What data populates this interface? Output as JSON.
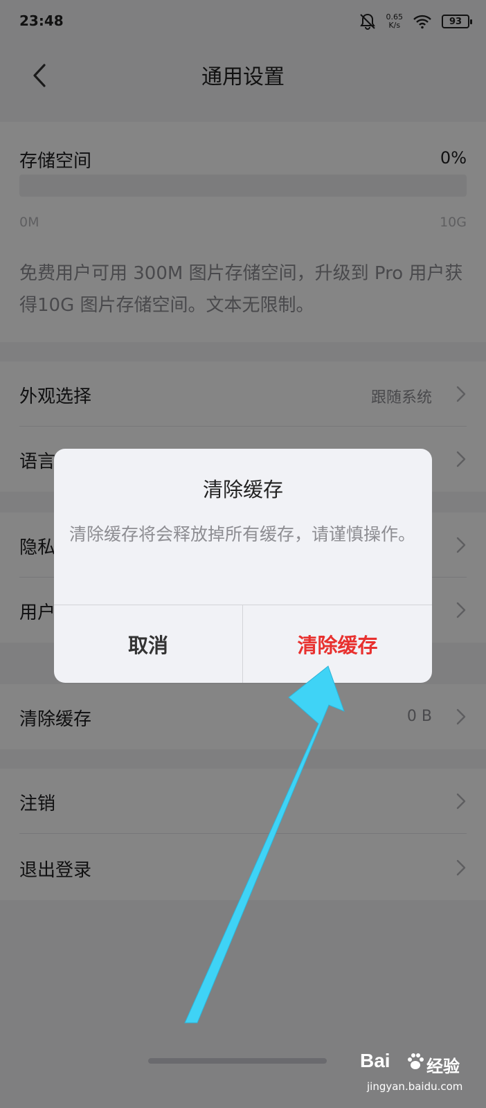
{
  "status_bar": {
    "time": "23:48",
    "speed_value": "0.65",
    "speed_unit": "K/s",
    "battery": "93",
    "icons": [
      "bell-muted-icon",
      "wifi-icon",
      "battery-icon"
    ]
  },
  "nav": {
    "title": "通用设置",
    "back_icon": "chevron-left-icon"
  },
  "storage": {
    "title": "存储空间",
    "percent_label": "0%",
    "used_fraction": 0,
    "min_label": "0M",
    "max_label": "10G",
    "description": "免费用户可用 300M 图片存储空间，升级到 Pro 用户获得10G 图片存储空间。文本无限制。"
  },
  "settings": {
    "appearance": {
      "label": "外观选择",
      "value": "跟随系统"
    },
    "language": {
      "label": "语言"
    },
    "privacy": {
      "label": "隐私"
    },
    "user": {
      "label": "用户"
    },
    "clear_cache": {
      "label": "清除缓存",
      "value": "0 B"
    },
    "logout_account": {
      "label": "注销"
    },
    "sign_out": {
      "label": "退出登录"
    }
  },
  "dialog": {
    "title": "清除缓存",
    "message": "清除缓存将会释放掉所有缓存，请谨慎操作。",
    "cancel_label": "取消",
    "confirm_label": "清除缓存"
  },
  "colors": {
    "confirm_red": "#e8312f",
    "annotation_arrow": "#3fd3f6",
    "dialog_bg": "#f1f2f6"
  },
  "watermark": {
    "brand_left": "Bai",
    "brand_right": "经验",
    "url": "jingyan.baidu.com"
  }
}
